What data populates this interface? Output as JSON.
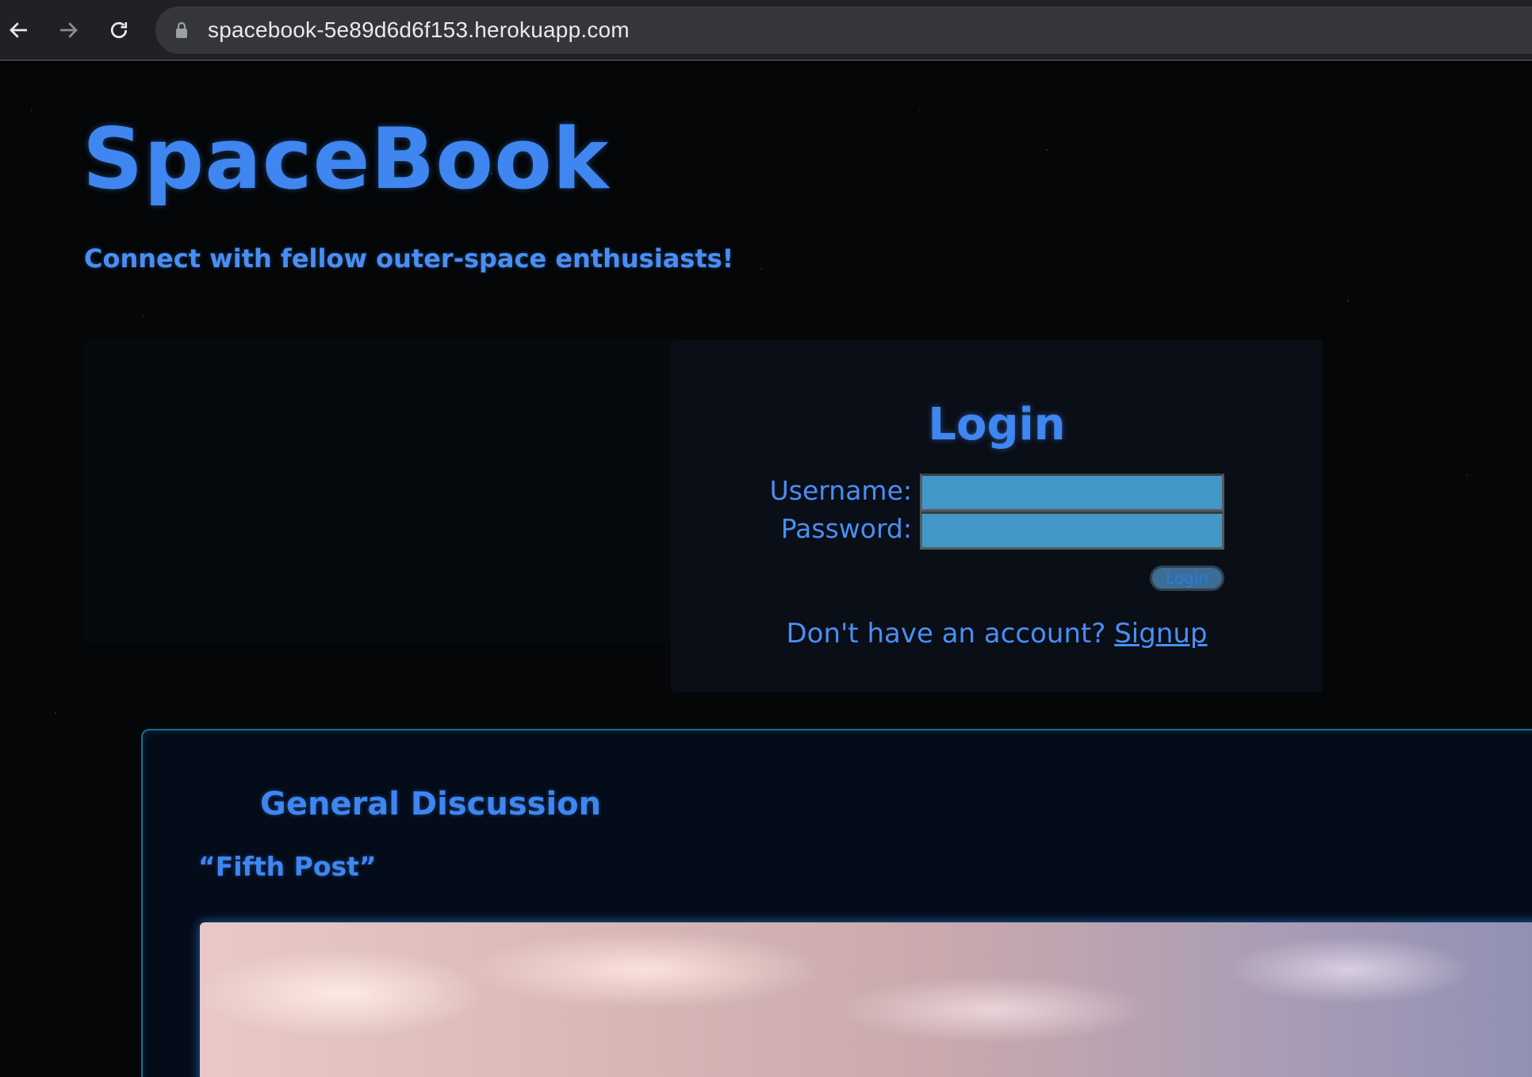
{
  "browser": {
    "url": "spacebook-5e89d6d6f153.herokuapp.com",
    "icons": [
      "back-arrow-icon",
      "forward-arrow-icon",
      "reload-icon",
      "lock-icon"
    ]
  },
  "header": {
    "title": "SpaceBook",
    "tagline": "Connect with fellow outer-space enthusiasts!"
  },
  "login": {
    "heading": "Login",
    "username_label": "Username:",
    "password_label": "Password:",
    "username_value": "",
    "password_value": "",
    "button_label": "Login",
    "signup_prompt": "Don't have an account?",
    "signup_link": "Signup"
  },
  "discussion": {
    "heading": "General Discussion",
    "post_title": "“Fifth Post”"
  },
  "colors": {
    "accent": "#3f86f0",
    "input_bg": "#4297c6",
    "panel_border": "#1d6a8a",
    "background": "#040608"
  }
}
